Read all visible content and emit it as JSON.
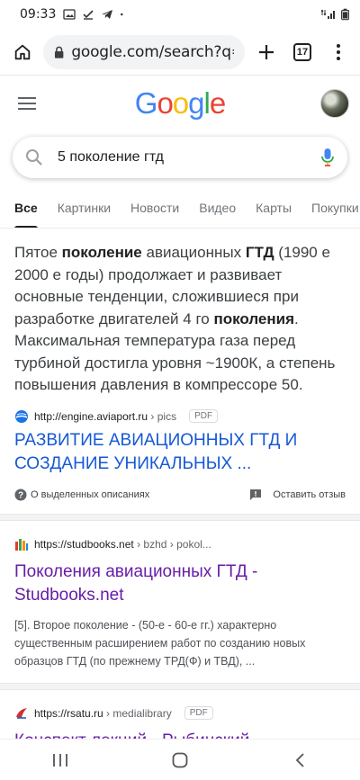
{
  "status": {
    "time": "09:33"
  },
  "browser": {
    "url": "google.com/search?q=",
    "tab_count": "17"
  },
  "search": {
    "query": "5 поколение гтд"
  },
  "tabs": [
    {
      "label": "Все",
      "active": true
    },
    {
      "label": "Картинки"
    },
    {
      "label": "Новости"
    },
    {
      "label": "Видео"
    },
    {
      "label": "Карты"
    },
    {
      "label": "Покупки"
    }
  ],
  "featured": {
    "snippet_parts": [
      {
        "t": "Пятое ",
        "b": false
      },
      {
        "t": "поколение",
        "b": true
      },
      {
        "t": " авиационных ",
        "b": false
      },
      {
        "t": "ГТД",
        "b": true
      },
      {
        "t": " (1990 е 2000 е годы) продолжает и развивает основные тенденции, сложившиеся при разработке двигателей 4 го ",
        "b": false
      },
      {
        "t": "поколения",
        "b": true
      },
      {
        "t": ". Максимальная температура газа перед турбиной достигла уровня ~1900К, а степень повышения давления в компрессоре 50.",
        "b": false
      }
    ],
    "source_url": "http://engine.aviaport.ru",
    "source_path": " › pics",
    "badge": "PDF",
    "title": "РАЗВИТИЕ АВИАЦИОННЫХ ГТД И СОЗДАНИЕ УНИКАЛЬНЫХ ...",
    "about_label": "О выделенных описаниях",
    "feedback_label": "Оставить отзыв"
  },
  "results": [
    {
      "source_url": "https://studbooks.net",
      "source_path": " › bzhd › pokol...",
      "title": "Поколения авиационных ГТД - Studbooks.net",
      "desc": "[5]. Второе поколение - (50-е - 60-е гг.) характерно существенным расширением работ по созданию новых образцов ГТД (по прежнему ТРД(Ф) и ТВД), ..."
    },
    {
      "source_url": "https://rsatu.ru",
      "source_path": " › medialibrary",
      "badge": "PDF",
      "title": "Конспект лекций - Рыбинский"
    }
  ],
  "colors": {
    "link_blue": "#1558d6",
    "visited_purple": "#681da8",
    "text": "#202124"
  }
}
